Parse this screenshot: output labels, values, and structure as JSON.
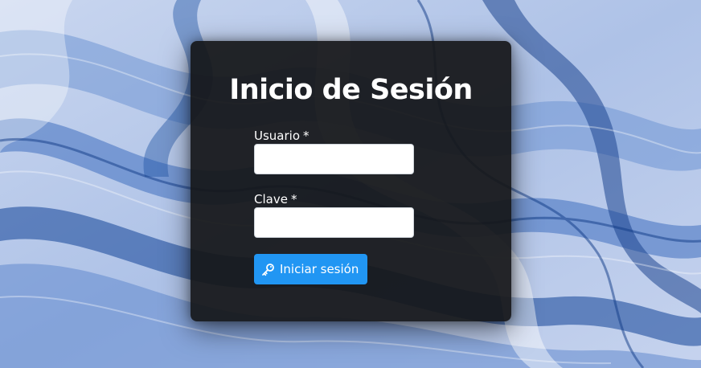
{
  "login": {
    "title": "Inicio de Sesión",
    "username": {
      "label": "Usuario",
      "required_marker": "*",
      "value": ""
    },
    "password": {
      "label": "Clave",
      "required_marker": "*",
      "value": ""
    },
    "submit": {
      "label": "Iniciar sesión",
      "icon": "key-icon"
    }
  },
  "colors": {
    "card_background": "#141618",
    "button_primary": "#2196f3",
    "text": "#ffffff",
    "background_blue": "#2a5ea8"
  }
}
